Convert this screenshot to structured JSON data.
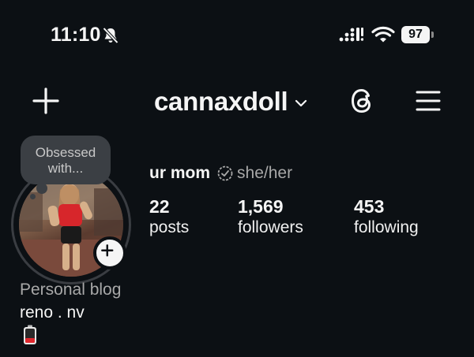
{
  "status_bar": {
    "time": "11:10",
    "battery": "97"
  },
  "header": {
    "username": "cannaxdoll"
  },
  "note": {
    "text_line1": "Obsessed",
    "text_line2": "with..."
  },
  "profile": {
    "display_name": "ur mom",
    "pronouns": "she/her",
    "category": "Personal blog",
    "bio": "reno . nv",
    "bio_emoji": "battery-low-icon"
  },
  "stats": [
    {
      "value": "22",
      "label": "posts"
    },
    {
      "value": "1,569",
      "label": "followers"
    },
    {
      "value": "453",
      "label": "following"
    }
  ],
  "colors": {
    "background": "#0c1014",
    "text": "#f5f5f5",
    "secondary_text": "#a8a8a8",
    "note_bubble": "#3b3f44"
  }
}
